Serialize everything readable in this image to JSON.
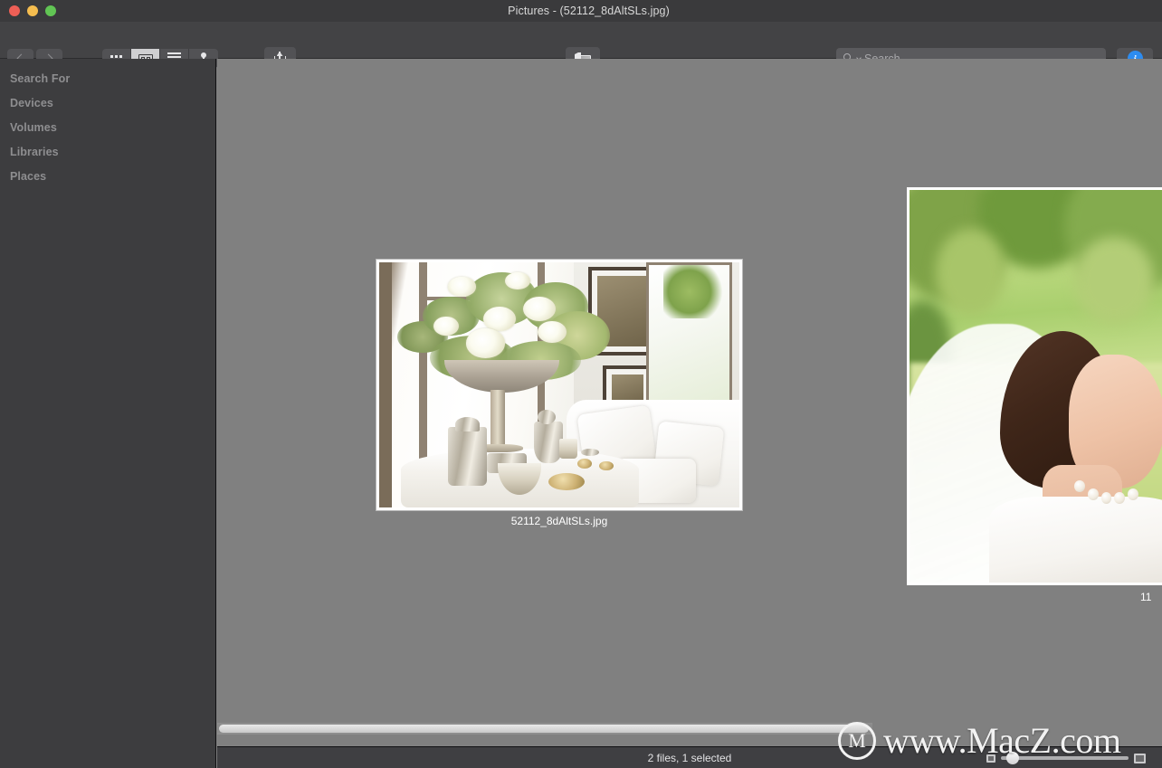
{
  "window": {
    "title": "Pictures - (52112_8dAltSLs.jpg)",
    "title_icon": "document-icon",
    "traffic_lights": [
      {
        "name": "close",
        "color": "#ee5f56"
      },
      {
        "name": "minimize",
        "color": "#f5bd4f"
      },
      {
        "name": "zoom",
        "color": "#61c554"
      }
    ]
  },
  "toolbar": {
    "back_icon": "chevron-left-icon",
    "forward_icon": "chevron-right-icon",
    "view_modes": [
      {
        "name": "icon-view",
        "icon": "grid-icon",
        "active": false
      },
      {
        "name": "coverflow-view",
        "icon": "coverflow-icon",
        "active": true
      },
      {
        "name": "list-view",
        "icon": "list-icon",
        "active": false
      },
      {
        "name": "place-view",
        "icon": "pin-icon",
        "active": false
      }
    ],
    "share_icon": "share-icon",
    "slideshow_icon": "photo-stack-icon",
    "info_icon": "info-icon",
    "info_color": "#2d8cf0"
  },
  "search": {
    "placeholder": "Search",
    "icon": "search-icon",
    "dropdown_icon": "chevron-down-icon",
    "value": ""
  },
  "sidebar": {
    "items": [
      {
        "label": "Search For",
        "name": "sidebar-item-search-for"
      },
      {
        "label": "Devices",
        "name": "sidebar-item-devices"
      },
      {
        "label": "Volumes",
        "name": "sidebar-item-volumes"
      },
      {
        "label": "Libraries",
        "name": "sidebar-item-libraries"
      },
      {
        "label": "Places",
        "name": "sidebar-item-places"
      }
    ]
  },
  "content": {
    "background_color": "#808080",
    "files": [
      {
        "name": "52112_8dAltSLs.jpg",
        "selected": true,
        "description": "Floral arrangement in silver bowl on white table with silver and gold tableware near bright window"
      },
      {
        "name": "11",
        "selected": false,
        "description": "Smiling bride in veil and pearl necklace outdoors in sunlit park"
      }
    ]
  },
  "statusbar": {
    "text": "2 files, 1 selected",
    "zoom_slider": {
      "small_icon": "small-thumbnail-icon",
      "large_icon": "large-thumbnail-icon",
      "value": 4
    }
  },
  "watermark": {
    "logo_letter": "M",
    "text": "www.MacZ.com"
  }
}
